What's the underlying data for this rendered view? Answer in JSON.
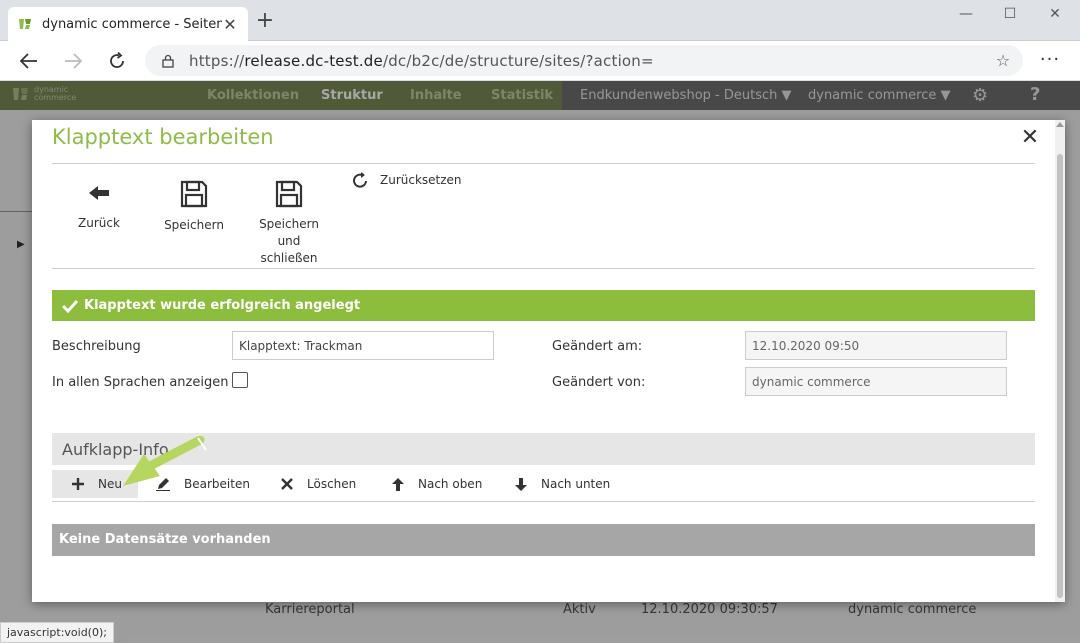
{
  "browser": {
    "tab_title": "dynamic commerce - Seiten",
    "url_prefix": "https://",
    "url_host": "release.dc-test.de",
    "url_path": "/dc/b2c/de/structure/sites/?action=",
    "status_url": "javascript:void(0);"
  },
  "app_nav": {
    "logo_line1": "dynamic",
    "logo_line2": "commerce",
    "items": [
      "Kollektionen",
      "Struktur",
      "Inhalte",
      "Statistik"
    ],
    "shop_select": "Endkundenwebshop - Deutsch",
    "company_select": "dynamic commerce",
    "help": "?"
  },
  "background_row": {
    "name": "Karriereportal",
    "status": "Aktiv",
    "date": "12.10.2020 09:30:57",
    "user": "dynamic commerce"
  },
  "modal": {
    "title": "Klapptext bearbeiten",
    "toolbar": {
      "back": "Zurück",
      "save": "Speichern",
      "save_close_line1": "Speichern und",
      "save_close_line2": "schließen",
      "reset": "Zurücksetzen"
    },
    "alert": "Klapptext wurde erfolgreich angelegt",
    "form": {
      "description_label": "Beschreibung",
      "description_value": "Klapptext: Trackman",
      "all_languages_label": "In allen Sprachen anzeigen",
      "all_languages_checked": false,
      "changed_at_label": "Geändert am:",
      "changed_at_value": "12.10.2020 09:50",
      "changed_by_label": "Geändert von:",
      "changed_by_value": "dynamic commerce"
    },
    "section": {
      "title": "Aufklapp-Info",
      "actions": {
        "new": "Neu",
        "edit": "Bearbeiten",
        "delete": "Löschen",
        "up": "Nach oben",
        "down": "Nach unten"
      },
      "empty": "Keine Datensätze vorhanden"
    }
  },
  "colors": {
    "accent_green": "#8dbd45",
    "alert_green": "#8dbd3c",
    "nav_green": "#7c8b58",
    "empty_gray": "#a6a6a6"
  }
}
